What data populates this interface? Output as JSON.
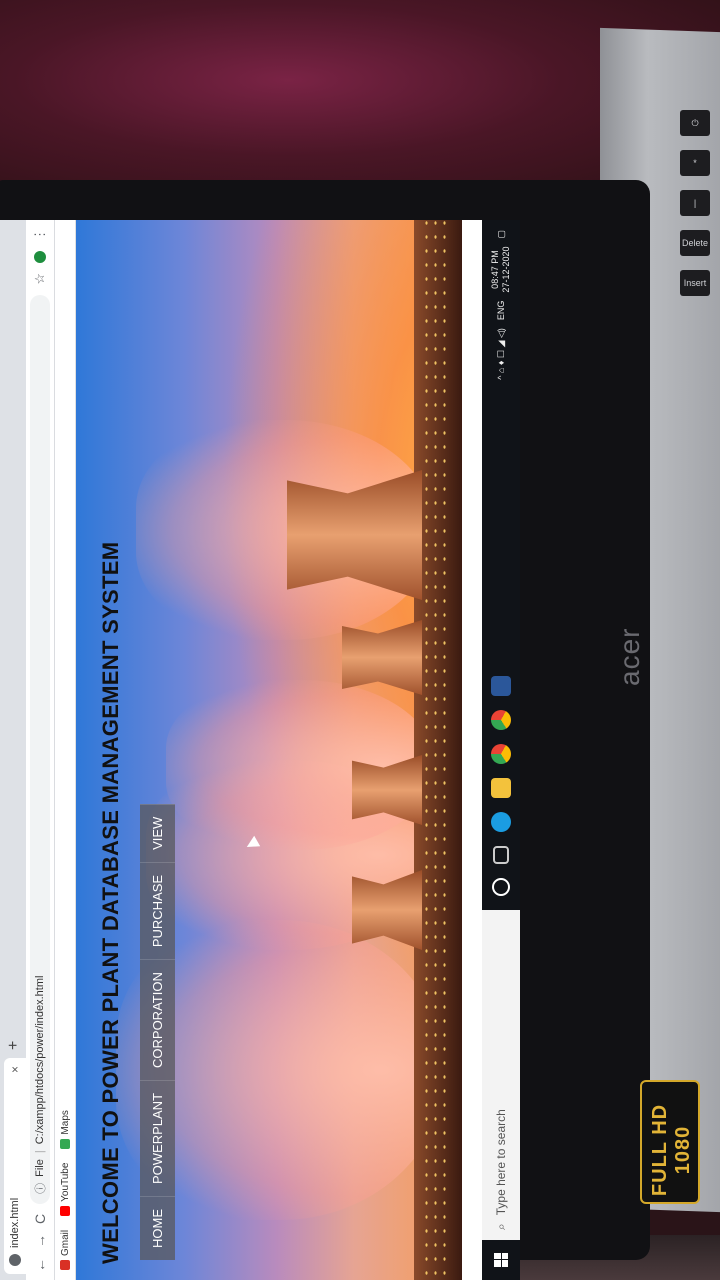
{
  "browser": {
    "tab_title": "index.html",
    "tab_close": "×",
    "new_tab": "+",
    "back": "←",
    "forward": "→",
    "reload": "C",
    "address_scheme": "File",
    "address_url": "C:/xampp/htdocs/power/index.html",
    "star": "☆",
    "menu": "⋮",
    "bookmarks": [
      {
        "label": "Gmail",
        "color": "#d93025"
      },
      {
        "label": "YouTube",
        "color": "#ff0000"
      },
      {
        "label": "Maps",
        "color": "#34a853"
      }
    ]
  },
  "site": {
    "title": "WELCOME TO POWER PLANT DATABASE MANAGEMENT SYSTEM",
    "nav": [
      "HOME",
      "POWERPLANT",
      "CORPORATION",
      "PURCHASE",
      "VIEW"
    ]
  },
  "taskbar": {
    "search_placeholder": "Type here to search",
    "search_icon": "⌕",
    "language": "ENG",
    "time": "08:47 PM",
    "date": "27-12-2020",
    "tray_icons": "^ ⌂ ♦ ☐ ◢ ◁)"
  },
  "device": {
    "brand": "acer",
    "badge": "FULL HD 1080",
    "keys": [
      "⏻",
      "*",
      "|",
      "Delete",
      "Insert"
    ]
  }
}
